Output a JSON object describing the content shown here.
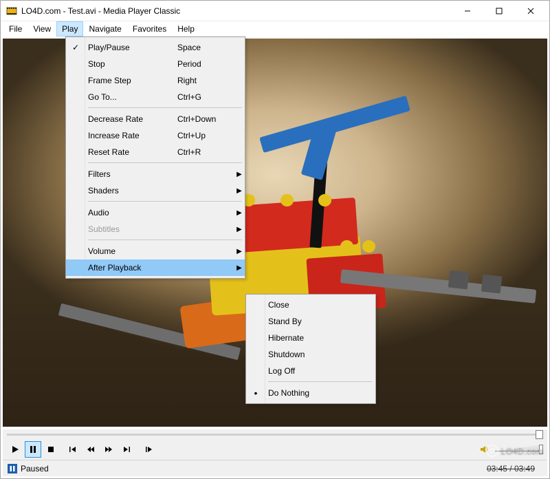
{
  "window": {
    "title": "LO4D.com - Test.avi - Media Player Classic"
  },
  "menubar": {
    "items": [
      "File",
      "View",
      "Play",
      "Navigate",
      "Favorites",
      "Help"
    ],
    "open_index": 2
  },
  "play_menu": {
    "items": [
      {
        "label": "Play/Pause",
        "accel": "Space",
        "checked": true
      },
      {
        "label": "Stop",
        "accel": "Period"
      },
      {
        "label": "Frame Step",
        "accel": "Right"
      },
      {
        "label": "Go To...",
        "accel": "Ctrl+G"
      },
      {
        "sep": true
      },
      {
        "label": "Decrease Rate",
        "accel": "Ctrl+Down"
      },
      {
        "label": "Increase Rate",
        "accel": "Ctrl+Up"
      },
      {
        "label": "Reset Rate",
        "accel": "Ctrl+R"
      },
      {
        "sep": true
      },
      {
        "label": "Filters",
        "submenu": true
      },
      {
        "label": "Shaders",
        "submenu": true
      },
      {
        "sep": true
      },
      {
        "label": "Audio",
        "submenu": true
      },
      {
        "label": "Subtitles",
        "submenu": true,
        "disabled": true
      },
      {
        "sep": true
      },
      {
        "label": "Volume",
        "submenu": true
      },
      {
        "label": "After Playback",
        "submenu": true,
        "highlighted": true
      }
    ]
  },
  "after_playback_sub": {
    "items": [
      {
        "label": "Close"
      },
      {
        "label": "Stand By"
      },
      {
        "label": "Hibernate"
      },
      {
        "label": "Shutdown"
      },
      {
        "label": "Log Off"
      },
      {
        "sep": true
      },
      {
        "label": "Do Nothing",
        "bullet": true
      }
    ]
  },
  "status": {
    "text": "Paused",
    "time_struck": "03:45 / 03:49"
  },
  "watermark": "LO4D.com"
}
